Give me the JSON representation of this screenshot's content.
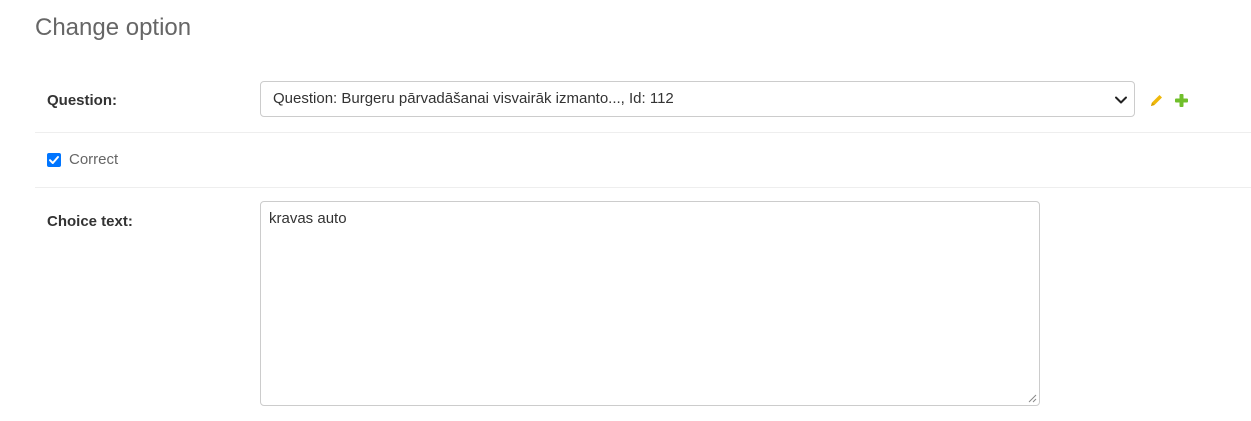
{
  "page": {
    "title": "Change option"
  },
  "question": {
    "label": "Question:",
    "selected_value": "Question: Burgeru pārvadāšanai visvairāk izmanto..., Id: 112",
    "edit_icon": "pencil-icon",
    "add_icon": "plus-icon",
    "edit_color": "#efb80b",
    "add_color": "#70bf2b"
  },
  "correct": {
    "label": "Correct",
    "checked": true,
    "accent_color": "#0075ff"
  },
  "choice_text": {
    "label": "Choice text:",
    "value": "kravas auto"
  }
}
